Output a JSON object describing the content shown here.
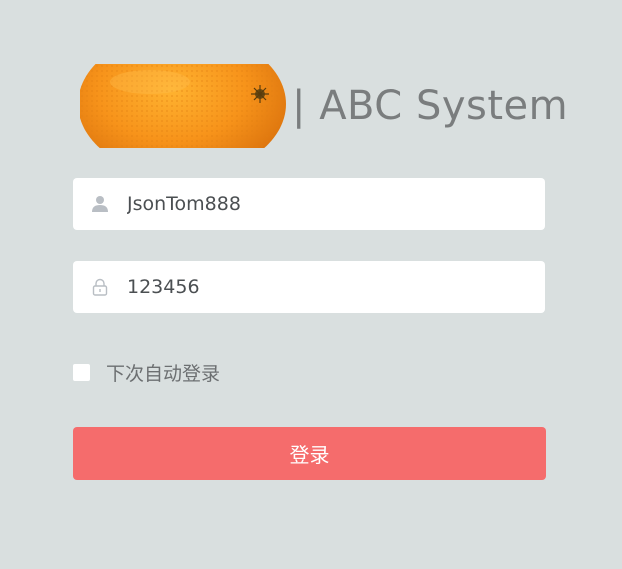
{
  "header": {
    "title": "| ABC System",
    "logo": "orange-image"
  },
  "login_form": {
    "username": {
      "value": "JsonTom888",
      "icon": "user-icon"
    },
    "password": {
      "value": "123456",
      "icon": "lock-icon"
    },
    "remember": {
      "label": "下次自动登录",
      "checked": false
    },
    "submit_label": "登录"
  },
  "colors": {
    "background": "#d9dfdf",
    "button": "#f56c6c",
    "title": "#7a7d7e"
  }
}
